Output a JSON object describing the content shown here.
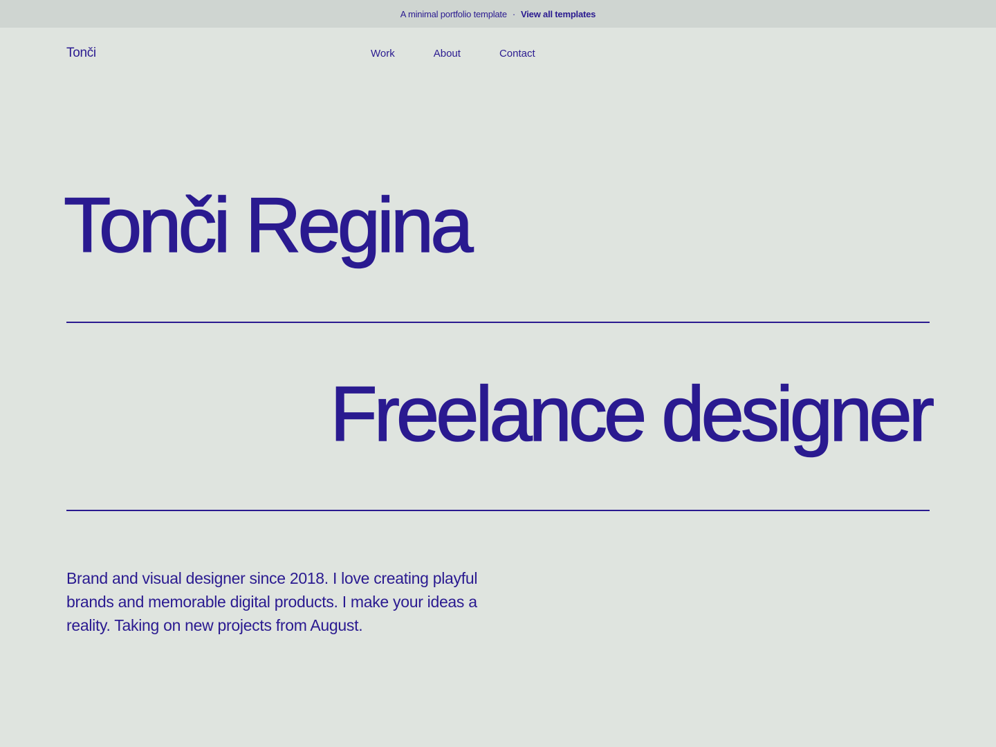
{
  "banner": {
    "text": "A minimal portfolio template",
    "separator": "·",
    "link_label": "View all templates"
  },
  "header": {
    "logo": "Tonči",
    "nav": [
      {
        "label": "Work"
      },
      {
        "label": "About"
      },
      {
        "label": "Contact"
      }
    ]
  },
  "hero": {
    "name": "Tonči Regina",
    "role": "Freelance designer",
    "bio": "Brand and visual designer since 2018. I love creating playful brands and memorable digital products. I make your ideas a reality. Taking on new projects from August."
  },
  "colors": {
    "background": "#dfe4df",
    "banner_background": "#cfd5d1",
    "accent": "#2a1a90"
  }
}
